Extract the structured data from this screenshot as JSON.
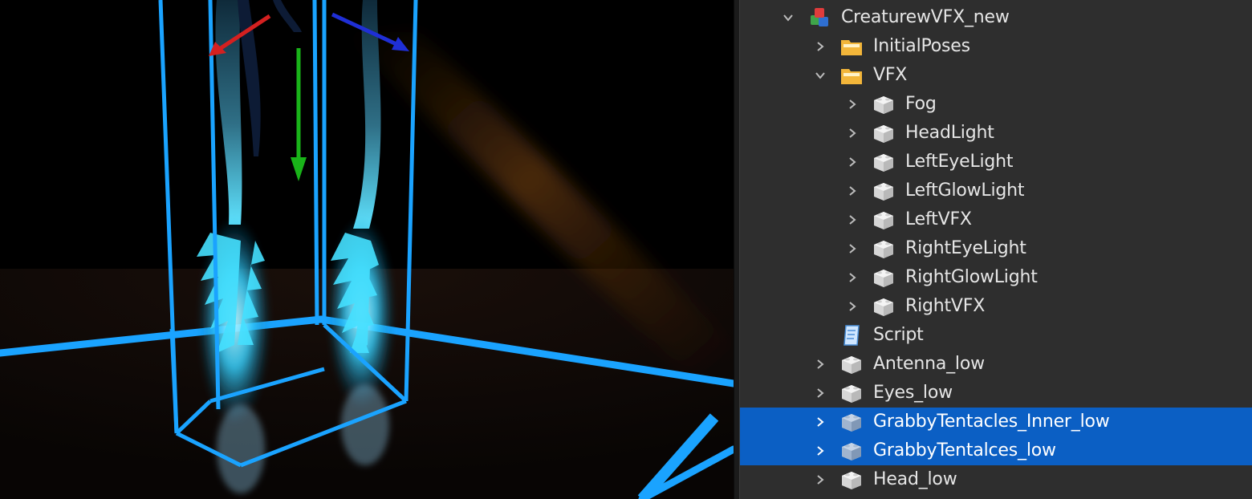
{
  "explorer": {
    "items": [
      {
        "label": "CreaturewVFX_new",
        "icon": "model-icon",
        "expander": "expanded",
        "selected": false
      },
      {
        "label": "InitialPoses",
        "icon": "folder-icon",
        "expander": "collapsed",
        "selected": false
      },
      {
        "label": "VFX",
        "icon": "folder-icon",
        "expander": "expanded",
        "selected": false
      },
      {
        "label": "Fog",
        "icon": "part-icon",
        "expander": "collapsed",
        "selected": false
      },
      {
        "label": "HeadLight",
        "icon": "part-icon",
        "expander": "collapsed",
        "selected": false
      },
      {
        "label": "LeftEyeLight",
        "icon": "part-icon",
        "expander": "collapsed",
        "selected": false
      },
      {
        "label": "LeftGlowLight",
        "icon": "part-icon",
        "expander": "collapsed",
        "selected": false
      },
      {
        "label": "LeftVFX",
        "icon": "part-icon",
        "expander": "collapsed",
        "selected": false
      },
      {
        "label": "RightEyeLight",
        "icon": "part-icon",
        "expander": "collapsed",
        "selected": false
      },
      {
        "label": "RightGlowLight",
        "icon": "part-icon",
        "expander": "collapsed",
        "selected": false
      },
      {
        "label": "RightVFX",
        "icon": "part-icon",
        "expander": "collapsed",
        "selected": false
      },
      {
        "label": "Script",
        "icon": "script-icon",
        "expander": "none",
        "selected": false
      },
      {
        "label": "Antenna_low",
        "icon": "part-icon",
        "expander": "collapsed",
        "selected": false
      },
      {
        "label": "Eyes_low",
        "icon": "part-icon",
        "expander": "collapsed",
        "selected": false
      },
      {
        "label": "GrabbyTentacles_Inner_low",
        "icon": "part-icon",
        "expander": "collapsed",
        "selected": true
      },
      {
        "label": "GrabbyTentalces_low",
        "icon": "part-icon",
        "expander": "collapsed",
        "selected": true
      },
      {
        "label": "Head_low",
        "icon": "part-icon",
        "expander": "collapsed",
        "selected": false
      }
    ]
  },
  "viewport": {
    "selection_box_color": "#1aa3ff",
    "glow_color": "#37d6ff",
    "gizmo": {
      "x_axis_color": "#d42020",
      "y_axis_color": "#19b319",
      "z_axis_color": "#1f2fd6"
    }
  },
  "colors": {
    "panel_bg": "#2e2e2e",
    "selection_bg": "#0b5fc4",
    "text": "#e6e6e6"
  }
}
